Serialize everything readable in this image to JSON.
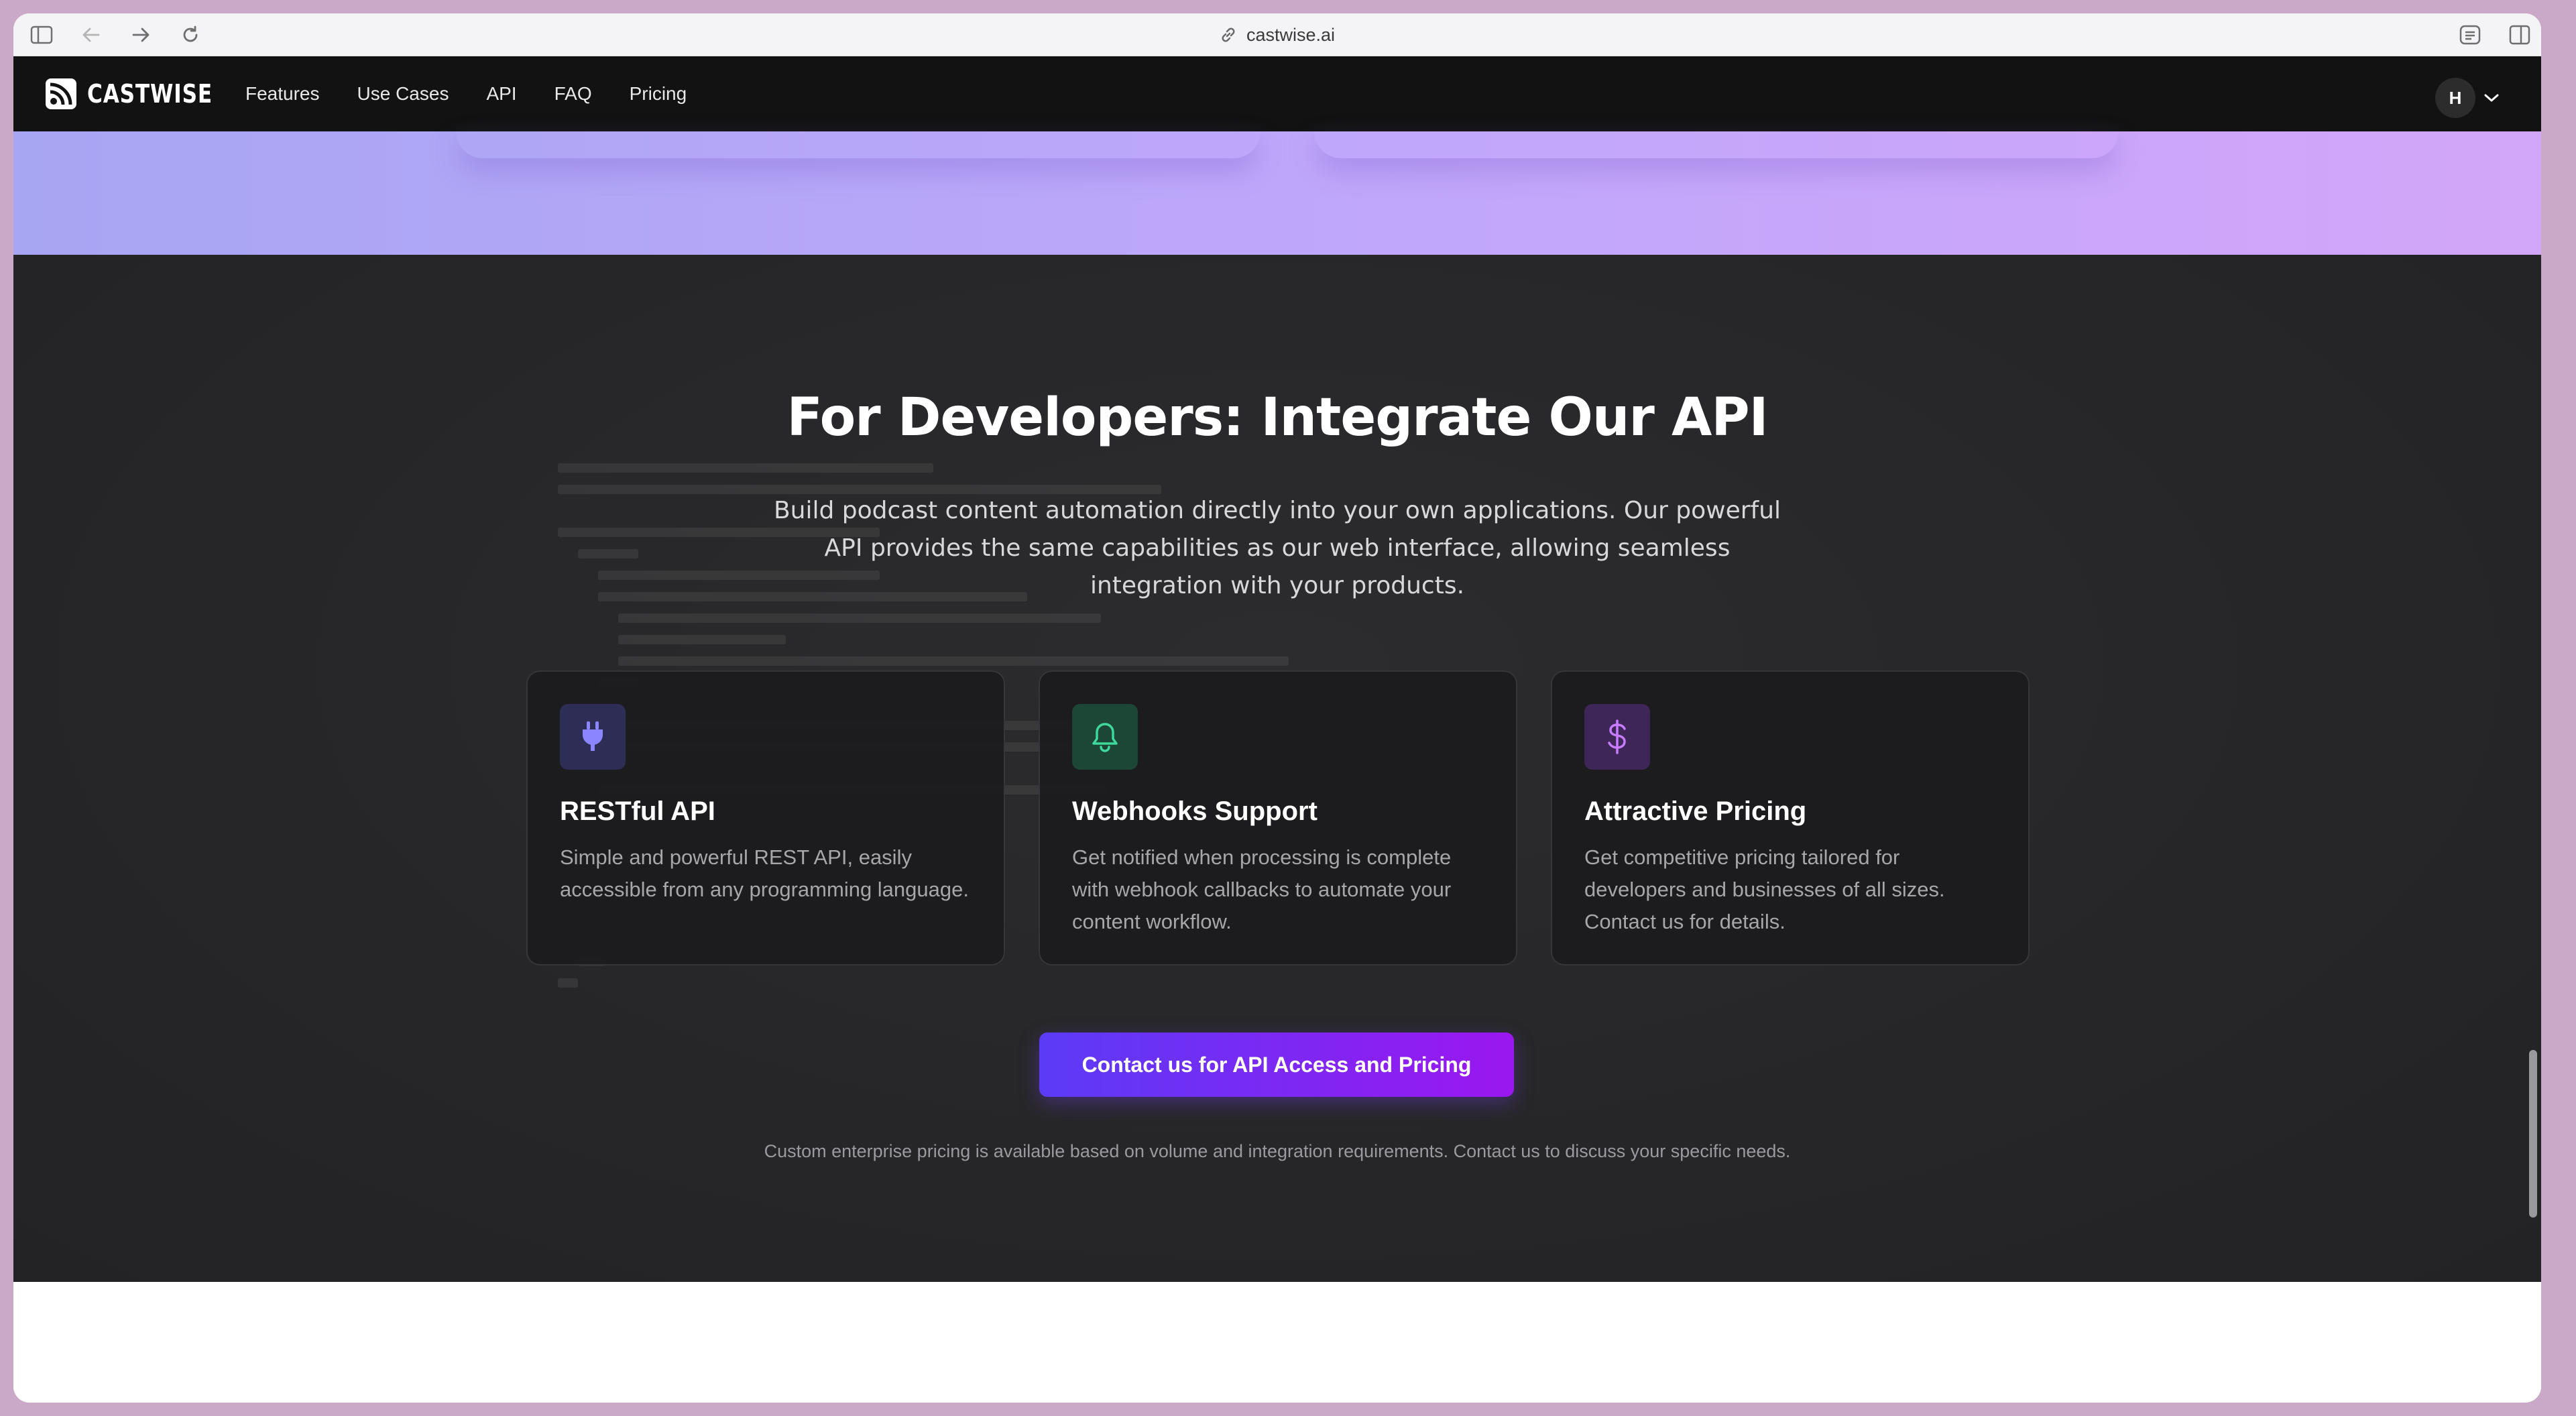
{
  "browser": {
    "url": "castwise.ai"
  },
  "nav": {
    "logo_text": "CASTWISE",
    "links": [
      "Features",
      "Use Cases",
      "API",
      "FAQ",
      "Pricing"
    ],
    "avatar_initial": "H"
  },
  "developers": {
    "title": "For Developers: Integrate Our API",
    "lead": "Build podcast content automation directly into your own applications. Our powerful API provides the same capabilities as our web interface, allowing seamless integration with your products.",
    "cards": [
      {
        "icon": "plug-icon",
        "title": "RESTful API",
        "text": "Simple and powerful REST API, easily accessible from any programming language."
      },
      {
        "icon": "bell-icon",
        "title": "Webhooks Support",
        "text": "Get notified when processing is complete with webhook callbacks to automate your content workflow."
      },
      {
        "icon": "dollar-icon",
        "title": "Attractive Pricing",
        "text": "Get competitive pricing tailored for developers and businesses of all sizes. Contact us for details."
      }
    ],
    "cta_label": "Contact us for API Access and Pricing",
    "note": "Custom enterprise pricing is available based on volume and integration requirements. Contact us to discuss your specific needs."
  },
  "colors": {
    "accent_start": "#5b3bf6",
    "accent_end": "#9b17f0",
    "nav_bg": "#121212",
    "section_bg": "#262628"
  }
}
